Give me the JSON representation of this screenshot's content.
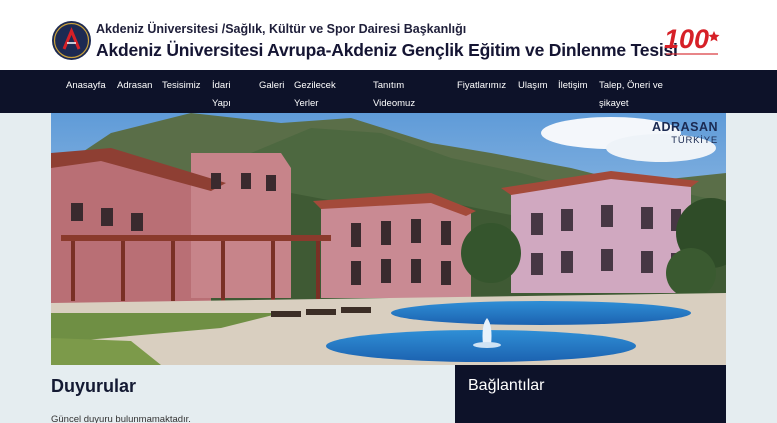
{
  "header": {
    "subtitle": "Akdeniz Üniversitesi /Sağlık, Kültür ve Spor Dairesi Başkanlığı",
    "title": "Akdeniz Üniversitesi Avrupa-Akdeniz Gençlik Eğitim ve Dinlenme Tesisi",
    "logo_icon": "university-logo-icon",
    "badge_icon": "centenary-100-badge-icon",
    "badge_text": "100"
  },
  "nav": {
    "items": [
      {
        "line1": "Anasayfa",
        "line2": ""
      },
      {
        "line1": "Adrasan",
        "line2": ""
      },
      {
        "line1": "Tesisimiz",
        "line2": ""
      },
      {
        "line1": "İdari",
        "line2": "Yapı"
      },
      {
        "line1": "Galeri",
        "line2": ""
      },
      {
        "line1": "Gezilecek",
        "line2": "Yerler"
      },
      {
        "line1": "Tanıtım",
        "line2": "Videomuz"
      },
      {
        "line1": "Fiyatlarımız",
        "line2": ""
      },
      {
        "line1": "Ulaşım",
        "line2": ""
      },
      {
        "line1": "İletişim",
        "line2": ""
      },
      {
        "line1": "Talep, Öneri ve",
        "line2": "şikayet"
      }
    ]
  },
  "hero": {
    "brand_line1": "ADRASAN",
    "brand_line2": "TÜRKİYE"
  },
  "announcements": {
    "title": "Duyurular",
    "empty_text": "Güncel duyuru bulunmamaktadır."
  },
  "links": {
    "title": "Bağlantılar"
  },
  "colors": {
    "nav_bg": "#0d1229",
    "page_bg": "#e5edf0",
    "accent_red": "#d62027"
  }
}
